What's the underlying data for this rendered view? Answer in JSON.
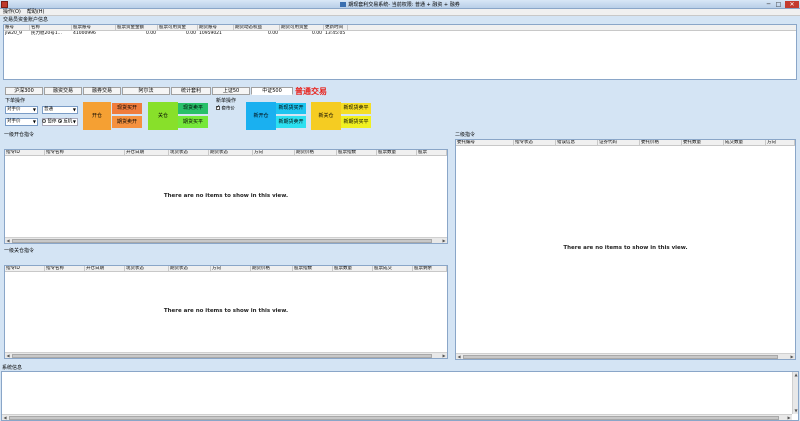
{
  "window": {
    "title": "期现套利交易系统- 当前权限: 普通 + 融资 + 融券",
    "min": "─",
    "max": "□",
    "close": "✕"
  },
  "menu": [
    {
      "label": "操作(O)"
    },
    {
      "label": "帮助(H)"
    }
  ],
  "accounts": {
    "section_label": "交易员资金账户信息",
    "columns": [
      "账号",
      "名称",
      "股票账号",
      "股票资金金额",
      "股票可用资金",
      "期货账号",
      "期货动态权益",
      "期货可用资金",
      "更新时间"
    ],
    "rows": [
      [
        "jlw20_9",
        "民力稳20号1...",
        "41000996",
        "0.00",
        "0.00",
        "10959021",
        "0.00",
        "0.00",
        "13:45:05"
      ]
    ]
  },
  "tabs": [
    {
      "label": "沪深300"
    },
    {
      "label": "融资交易"
    },
    {
      "label": "融券交易"
    },
    {
      "label": "阿尔法"
    },
    {
      "label": "统计套利"
    },
    {
      "label": "上证50"
    },
    {
      "label": "中证500"
    }
  ],
  "mode_label": "普通交易",
  "order_ops": {
    "label": "下单操作",
    "select1": "对手价",
    "select2": "普通",
    "select3": "对手价",
    "select4": "",
    "radio_stop": "暂停",
    "radio_reverse": "反机"
  },
  "open_group": {
    "main": "开仓",
    "spot_buy": "现货买开",
    "futures_sell": "期货卖开"
  },
  "close_group": {
    "main": "关仓",
    "spot_sell": "现货卖平",
    "futures_buy": "期货买平"
  },
  "new_ops": {
    "label": "新单操作",
    "checkbox": "套市价",
    "open": "新开仓",
    "spot_buy": "新现货买开",
    "futures_sell": "新期货卖开",
    "close": "新关仓",
    "spot_sell": "新现货卖平",
    "futures_buy": "新期货买平"
  },
  "level1_open": {
    "label": "一级开仓指令",
    "columns": [
      "指令ID",
      "指令名称",
      "开仓日期",
      "现货状态",
      "期货状态",
      "方向",
      "期货价格",
      "股票指数",
      "股票数量",
      "股票"
    ],
    "empty": "There are no items to show in this view."
  },
  "level1_close": {
    "label": "一级关仓指令",
    "columns": [
      "指令ID",
      "指令名称",
      "开仓日期",
      "现货状态",
      "期货状态",
      "方向",
      "期货价格",
      "股票指数",
      "股票数量",
      "股票成交",
      "股票剩余"
    ],
    "empty": "There are no items to show in this view."
  },
  "level2": {
    "label": "二级指令",
    "columns": [
      "委托编号",
      "指令状态",
      "错误信息",
      "证券代码",
      "委托价格",
      "委托数量",
      "成交数量",
      "方向"
    ],
    "empty": "There are no items to show in this view."
  },
  "system_info": {
    "label": "系统信息"
  },
  "colors": {
    "open_main": "#f5a033",
    "open_spot": "#f07c3c",
    "open_fut": "#f5913f",
    "close_main": "#88e02a",
    "close_spot": "#28c06a",
    "close_fut": "#76e83a",
    "new_open_main": "#1ab0f0",
    "new_open_spot": "#1fc4f0",
    "new_open_fut": "#2de0f0",
    "new_close_main": "#f5cc22",
    "new_close_spot": "#f5de25",
    "new_close_fut": "#f0f020",
    "mode_label": "#e8201a"
  }
}
